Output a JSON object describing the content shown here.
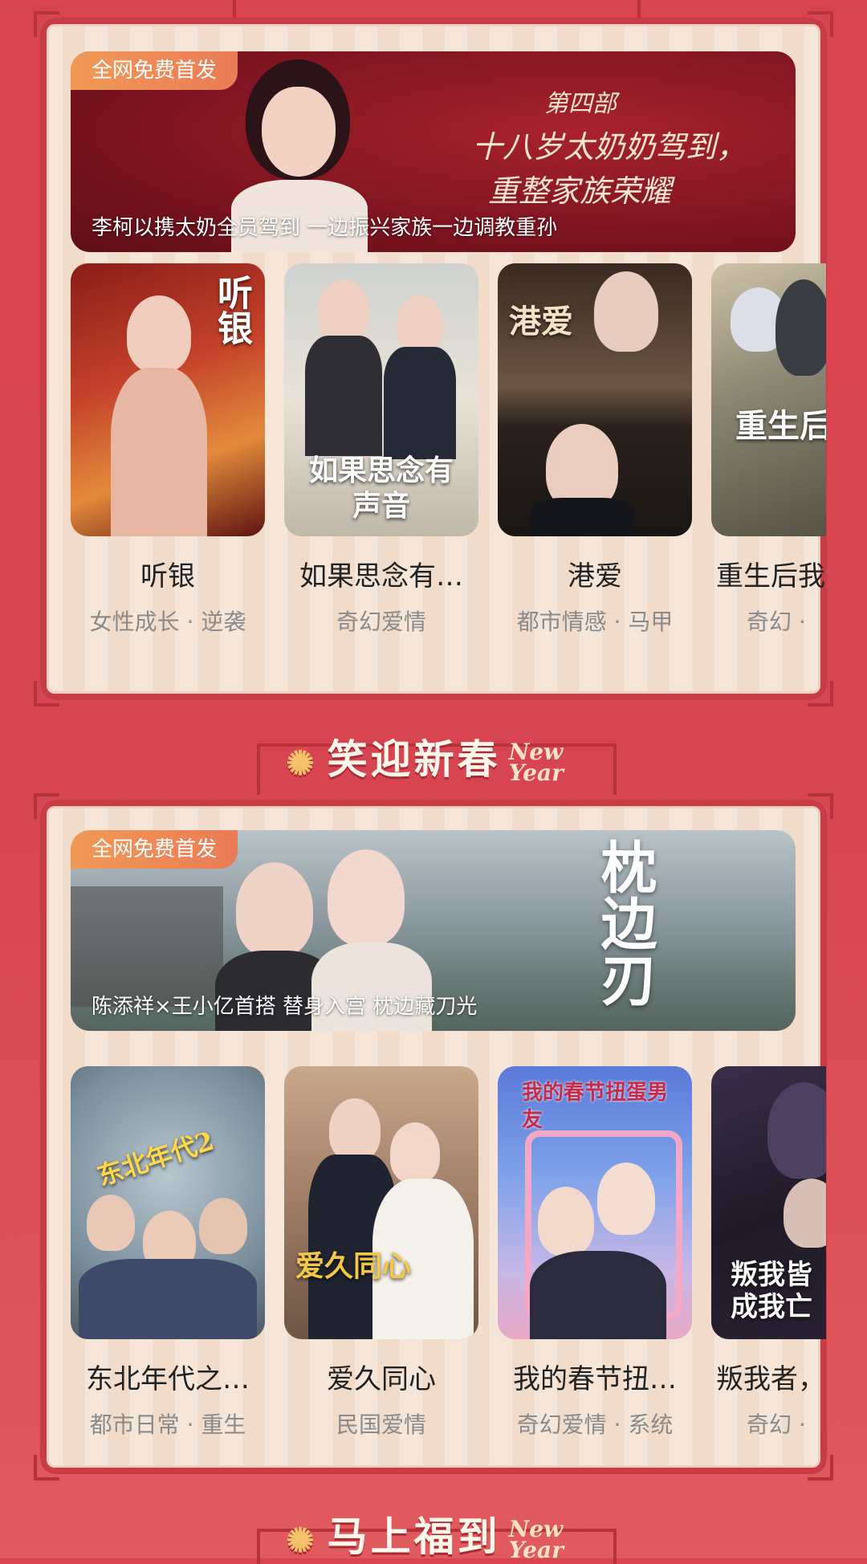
{
  "section1": {
    "badge": "全网免费首发",
    "banner_title_small": "第四部",
    "banner_title_line1": "十八岁太奶奶驾到，",
    "banner_title_line2": "重整家族荣耀",
    "banner_caption": "李柯以携太奶全员驾到 一边振兴家族一边调教重孙",
    "dramas": [
      {
        "title": "听银",
        "tags": "女性成长 · 逆袭",
        "cover_text": "听银"
      },
      {
        "title": "如果思念有…",
        "tags": "奇幻爱情",
        "cover_text": "如果思念有声音"
      },
      {
        "title": "港爱",
        "tags": "都市情感 · 马甲",
        "cover_text": "港爱"
      },
      {
        "title": "重生后我",
        "tags": "奇幻 · ",
        "cover_text": "重生后"
      }
    ]
  },
  "divider1": {
    "title": "笑迎新春",
    "deco": "New Year"
  },
  "section2": {
    "badge": "全网免费首发",
    "banner_title": "枕边刃",
    "banner_caption": "陈添祥×王小亿首搭 替身入宫 枕边藏刀光",
    "dramas": [
      {
        "title": "东北年代之…",
        "tags": "都市日常 · 重生",
        "cover_text": "东北年代2"
      },
      {
        "title": "爱久同心",
        "tags": "民国爱情",
        "cover_text": "爱久同心"
      },
      {
        "title": "我的春节扭…",
        "tags": "奇幻爱情 · 系统",
        "cover_text": "我的春节扭蛋男友"
      },
      {
        "title": "叛我者，",
        "tags": "奇幻 · ",
        "cover_text": "叛我皆成我亡"
      }
    ]
  },
  "divider2": {
    "title": "马上福到",
    "deco": "New Year"
  }
}
